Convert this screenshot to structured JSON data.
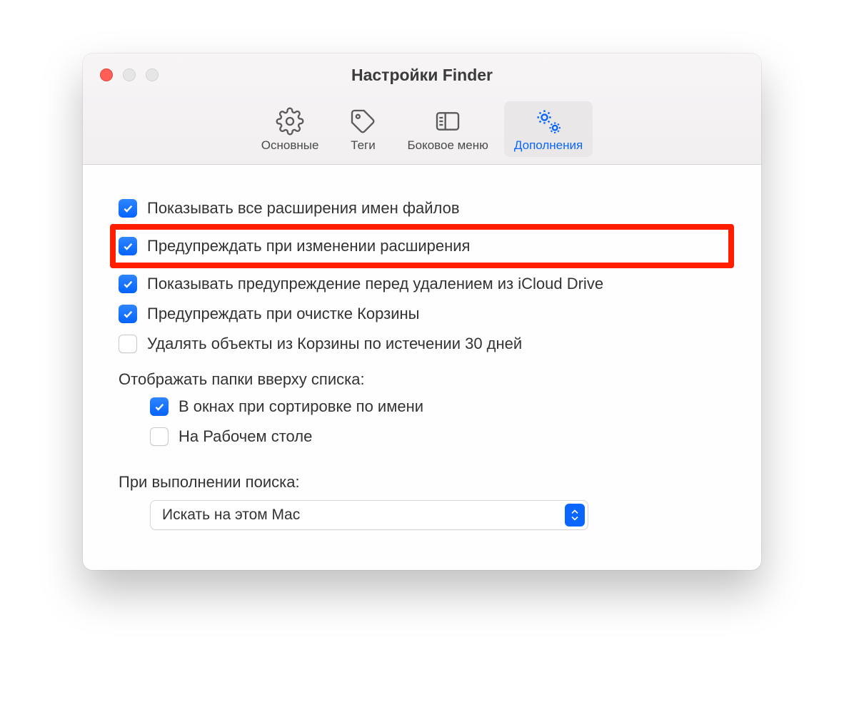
{
  "window": {
    "title": "Настройки Finder"
  },
  "tabs": {
    "general": "Основные",
    "tags": "Теги",
    "sidebar": "Боковое меню",
    "advanced": "Дополнения"
  },
  "checkboxes": {
    "show_extensions": "Показывать все расширения имен файлов",
    "warn_extension_change": "Предупреждать при изменении расширения",
    "warn_icloud_remove": "Показывать предупреждение перед удалением из iCloud Drive",
    "warn_empty_trash": "Предупреждать при очистке Корзины",
    "remove_after_30_days": "Удалять объекты из Корзины по истечении 30 дней"
  },
  "folders_section": {
    "label": "Отображать папки вверху списка:",
    "in_windows": "В окнах при сортировке по имени",
    "on_desktop": "На Рабочем столе"
  },
  "search_section": {
    "label": "При выполнении поиска:",
    "selected": "Искать на этом Mac"
  }
}
